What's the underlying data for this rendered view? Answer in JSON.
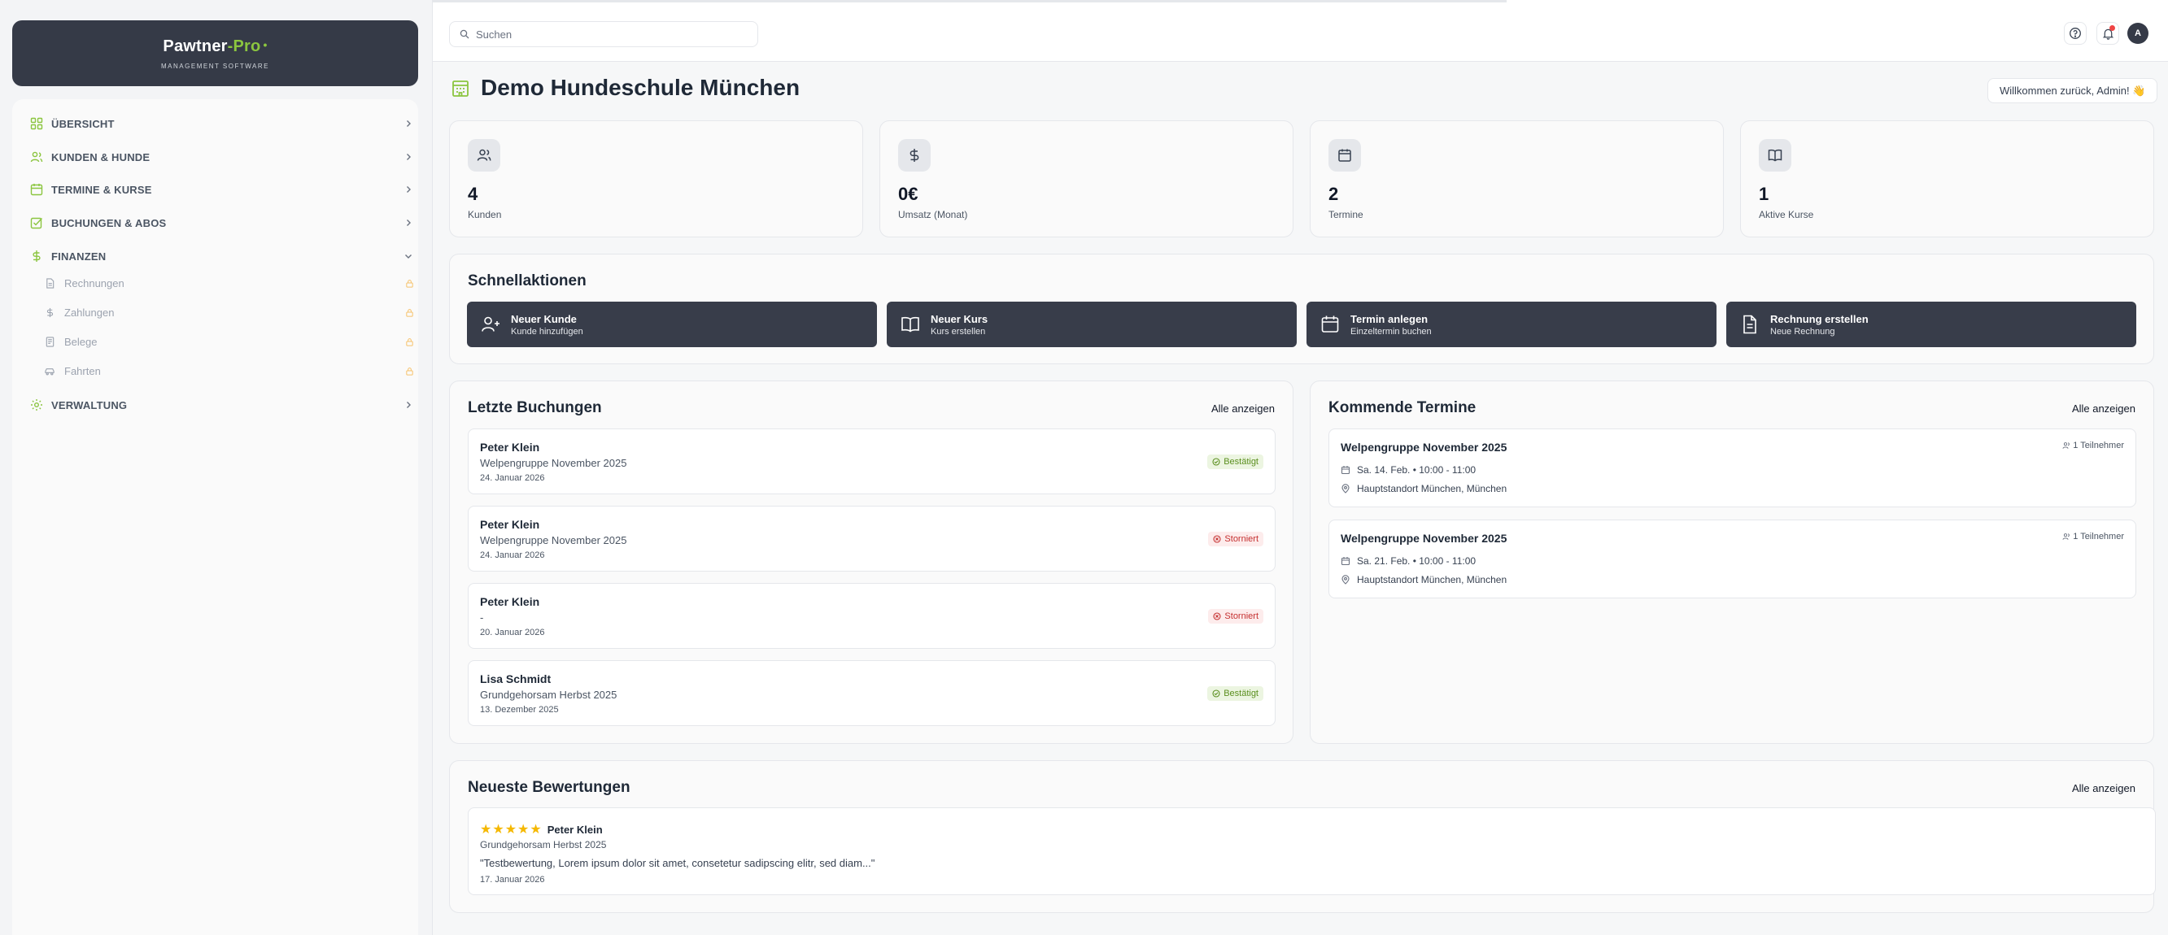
{
  "brand": {
    "name_main": "Pawtner",
    "name_sep": "-",
    "name_accent": "Pro",
    "tagline": "MANAGEMENT SOFTWARE",
    "accent_color": "#8bc53f",
    "dark_color": "#353a47"
  },
  "sidebar": {
    "items": [
      {
        "label": "ÜBERSICHT",
        "icon": "grid-icon",
        "chevron": "right"
      },
      {
        "label": "KUNDEN & HUNDE",
        "icon": "users-icon",
        "chevron": "right"
      },
      {
        "label": "TERMINE & KURSE",
        "icon": "calendar-icon",
        "chevron": "right"
      },
      {
        "label": "BUCHUNGEN & ABOS",
        "icon": "check-square-icon",
        "chevron": "right"
      },
      {
        "label": "FINANZEN",
        "icon": "dollar-icon",
        "chevron": "down"
      },
      {
        "label": "VERWALTUNG",
        "icon": "gear-icon",
        "chevron": "right"
      }
    ],
    "finance_sub": [
      {
        "label": "Rechnungen",
        "icon": "file-icon",
        "locked": true
      },
      {
        "label": "Zahlungen",
        "icon": "dollar-icon",
        "locked": true
      },
      {
        "label": "Belege",
        "icon": "receipt-icon",
        "locked": true
      },
      {
        "label": "Fahrten",
        "icon": "car-icon",
        "locked": true
      }
    ]
  },
  "topbar": {
    "search_placeholder": "Suchen",
    "avatar_initial": "A"
  },
  "header": {
    "title": "Demo Hundeschule München",
    "welcome": "Willkommen zurück, Admin! 👋"
  },
  "stats": [
    {
      "value": "4",
      "label": "Kunden",
      "icon": "users-icon"
    },
    {
      "value": "0€",
      "label": "Umsatz (Monat)",
      "icon": "dollar-icon"
    },
    {
      "value": "2",
      "label": "Termine",
      "icon": "calendar-icon"
    },
    {
      "value": "1",
      "label": "Aktive Kurse",
      "icon": "book-icon"
    }
  ],
  "quick_actions": {
    "title": "Schnellaktionen",
    "items": [
      {
        "title": "Neuer Kunde",
        "subtitle": "Kunde hinzufügen",
        "icon": "user-plus-icon"
      },
      {
        "title": "Neuer Kurs",
        "subtitle": "Kurs erstellen",
        "icon": "book-icon"
      },
      {
        "title": "Termin anlegen",
        "subtitle": "Einzeltermin buchen",
        "icon": "calendar-icon"
      },
      {
        "title": "Rechnung erstellen",
        "subtitle": "Neue Rechnung",
        "icon": "file-icon"
      }
    ]
  },
  "bookings": {
    "title": "Letzte Buchungen",
    "show_all": "Alle anzeigen",
    "items": [
      {
        "name": "Peter Klein",
        "course": "Welpengruppe November 2025",
        "date": "24. Januar 2026",
        "status": "Bestätigt",
        "status_type": "ok"
      },
      {
        "name": "Peter Klein",
        "course": "Welpengruppe November 2025",
        "date": "24. Januar 2026",
        "status": "Storniert",
        "status_type": "cancel"
      },
      {
        "name": "Peter Klein",
        "course": "-",
        "date": "20. Januar 2026",
        "status": "Storniert",
        "status_type": "cancel"
      },
      {
        "name": "Lisa Schmidt",
        "course": "Grundgehorsam Herbst 2025",
        "date": "13. Dezember 2025",
        "status": "Bestätigt",
        "status_type": "ok"
      }
    ]
  },
  "appointments": {
    "title": "Kommende Termine",
    "show_all": "Alle anzeigen",
    "items": [
      {
        "title": "Welpengruppe November 2025",
        "participants": "1 Teilnehmer",
        "when": "Sa. 14. Feb. • 10:00 - 11:00",
        "where": "Hauptstandort München, München"
      },
      {
        "title": "Welpengruppe November 2025",
        "participants": "1 Teilnehmer",
        "when": "Sa. 21. Feb. • 10:00 - 11:00",
        "where": "Hauptstandort München, München"
      }
    ]
  },
  "reviews": {
    "title": "Neueste Bewertungen",
    "show_all": "Alle anzeigen",
    "items": [
      {
        "rating": 5,
        "name": "Peter Klein",
        "course": "Grundgehorsam Herbst 2025",
        "text": "\"Testbewertung, Lorem ipsum dolor sit amet, consetetur sadipscing elitr, sed diam...\"",
        "date": "17. Januar 2026"
      }
    ]
  }
}
